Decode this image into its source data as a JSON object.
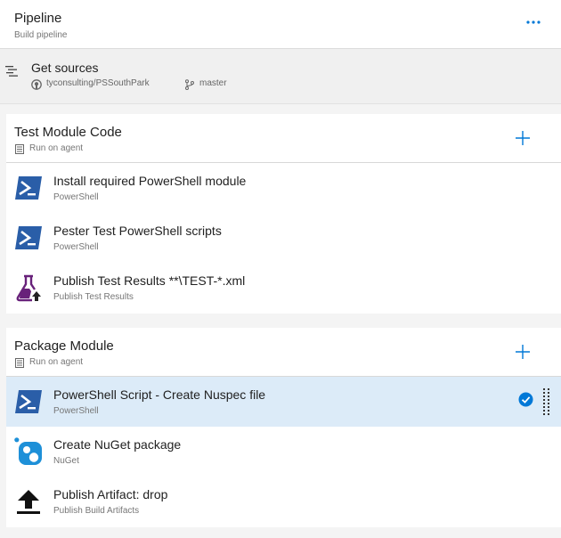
{
  "pipeline": {
    "title": "Pipeline",
    "subtitle": "Build pipeline",
    "more_icon": "more-ellipsis-icon"
  },
  "sources": {
    "title": "Get sources",
    "repo": "tyconsulting/PSSouthPark",
    "branch": "master",
    "icons": [
      "sources-list-icon",
      "github-icon",
      "branch-icon"
    ]
  },
  "phases": [
    {
      "title": "Test Module Code",
      "agent": "Run on agent",
      "tasks": [
        {
          "name": "Install required PowerShell module",
          "type": "PowerShell",
          "icon": "powershell-icon"
        },
        {
          "name": "Pester Test PowerShell scripts",
          "type": "PowerShell",
          "icon": "powershell-icon"
        },
        {
          "name": "Publish Test Results **\\TEST-*.xml",
          "type": "Publish Test Results",
          "icon": "flask-upload-icon"
        }
      ]
    },
    {
      "title": "Package Module",
      "agent": "Run on agent",
      "tasks": [
        {
          "name": "PowerShell Script - Create Nuspec file",
          "type": "PowerShell",
          "icon": "powershell-icon",
          "selected": true,
          "enabled": true
        },
        {
          "name": "Create NuGet package",
          "type": "NuGet",
          "icon": "nuget-icon"
        },
        {
          "name": "Publish Artifact: drop",
          "type": "Publish Build Artifacts",
          "icon": "upload-arrow-icon"
        }
      ]
    }
  ],
  "colors": {
    "accent": "#0078d7",
    "selected_row": "#dcebf8",
    "powershell": "#2a5ea8",
    "nuget": "#1e90d8",
    "flask": "#68217a"
  }
}
